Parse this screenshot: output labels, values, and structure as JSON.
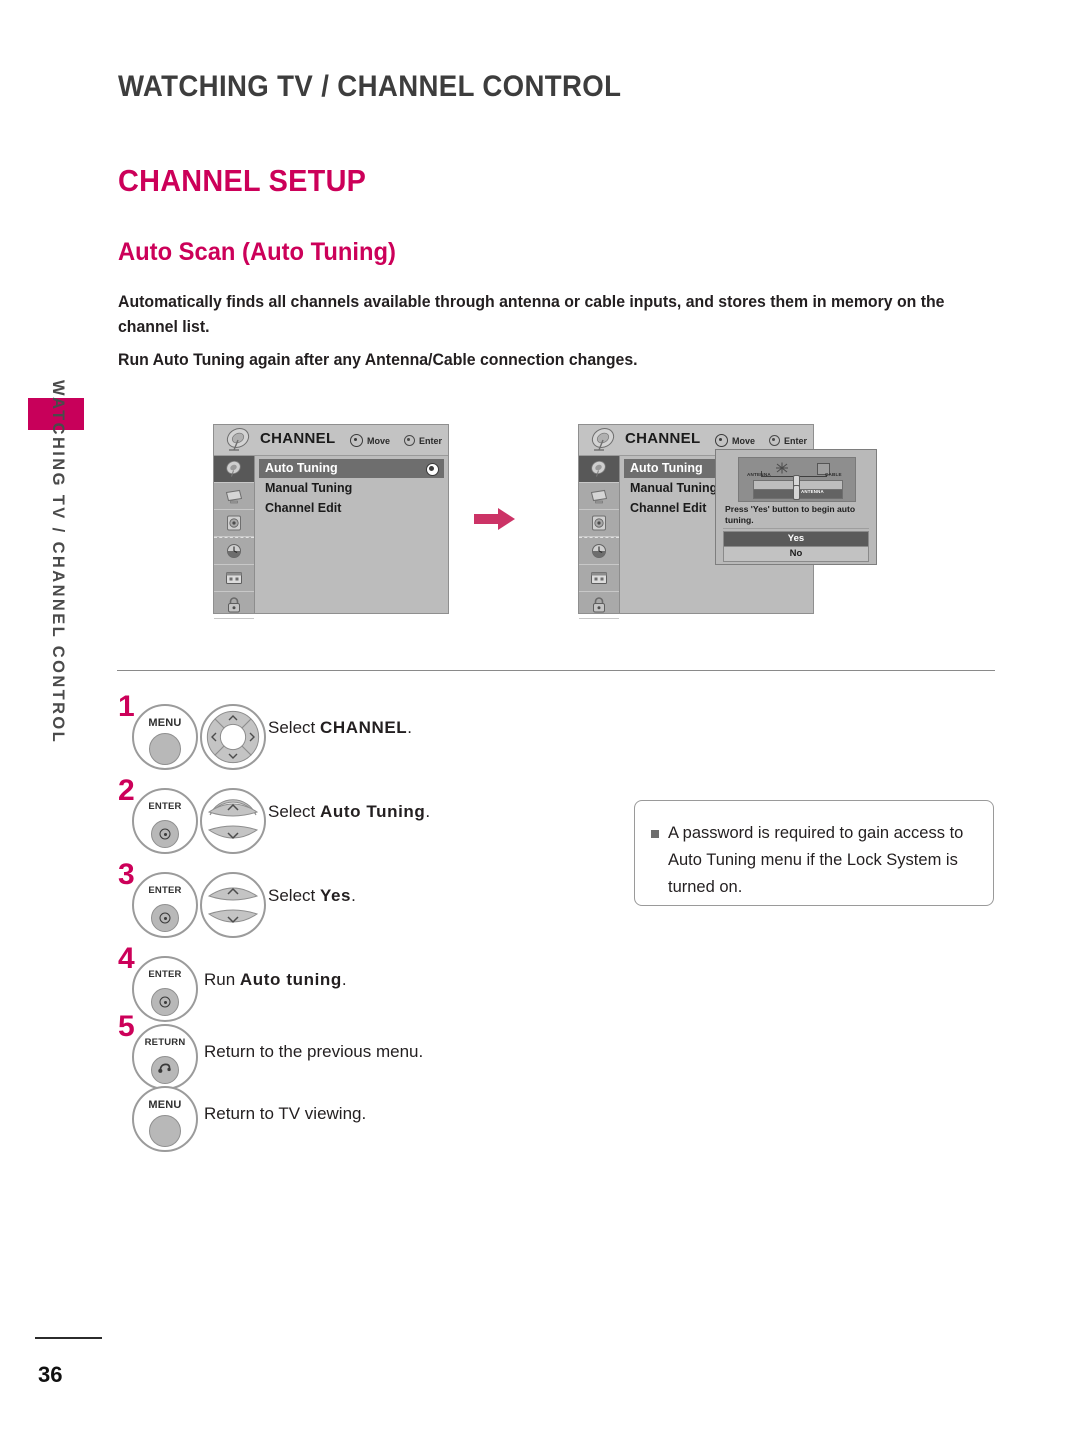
{
  "chapter_tab": {
    "vertical_label": "WATCHING TV / CHANNEL CONTROL",
    "accent_color": "#c8005a"
  },
  "header": {
    "title": "WATCHING TV / CHANNEL CONTROL"
  },
  "section": {
    "title": "CHANNEL SETUP",
    "subtitle": "Auto Scan (Auto Tuning)",
    "accent_color": "#cc0059"
  },
  "intro": {
    "paragraph1": "Automatically finds all channels available through antenna or cable inputs, and stores them in memory on the channel list.",
    "paragraph2": "Run Auto Tuning again after any Antenna/Cable connection changes."
  },
  "osd": {
    "title": "CHANNEL",
    "hint_move": "Move",
    "hint_enter": "Enter",
    "menu_items": [
      {
        "label": "Auto Tuning",
        "selected": true
      },
      {
        "label": "Manual Tuning",
        "selected": false
      },
      {
        "label": "Channel Edit",
        "selected": false
      }
    ],
    "rail_icons": [
      "channel-dish-icon",
      "picture-tv-icon",
      "audio-speaker-icon",
      "time-clock-icon",
      "option-calendar-icon",
      "lock-padlock-icon"
    ]
  },
  "dialog": {
    "graphic_label_antenna": "ANTENNA",
    "graphic_label_cable": "CABLE",
    "graphic_label_selected": "ANTENNA",
    "message": "Press 'Yes' button to begin auto tuning.",
    "buttons": [
      {
        "label": "Yes",
        "selected": true
      },
      {
        "label": "No",
        "selected": false
      }
    ]
  },
  "flow": {
    "arrow_icon": "right-arrow-icon",
    "arrow_color": "#cc3366"
  },
  "steps": [
    {
      "number": "1",
      "button_label": "MENU",
      "button_type": "menu",
      "wheel": "four-way",
      "text_prefix": "Select ",
      "text_bold": "CHANNEL",
      "text_suffix": "."
    },
    {
      "number": "2",
      "button_label": "ENTER",
      "button_type": "enter",
      "wheel": "up-down",
      "text_prefix": "Select ",
      "text_bold": "Auto Tuning",
      "text_suffix": "."
    },
    {
      "number": "3",
      "button_label": "ENTER",
      "button_type": "enter",
      "wheel": "up-down",
      "text_prefix": "Select ",
      "text_bold": "Yes",
      "text_suffix": "."
    },
    {
      "number": "4",
      "button_label": "ENTER",
      "button_type": "enter",
      "wheel": "none",
      "text_prefix": "Run ",
      "text_bold": "Auto tuning",
      "text_suffix": "."
    },
    {
      "number": "5",
      "button_label": "RETURN",
      "button_type": "return",
      "wheel": "none",
      "text_prefix": "Return to the previous menu.",
      "text_bold": "",
      "text_suffix": ""
    },
    {
      "number": "",
      "button_label": "MENU",
      "button_type": "menu",
      "wheel": "none",
      "text_prefix": "Return to TV viewing.",
      "text_bold": "",
      "text_suffix": ""
    }
  ],
  "note": {
    "bullet_icon": "square-bullet-icon",
    "text": "A password is required to gain access to Auto Tuning menu if the Lock System is turned on."
  },
  "footer": {
    "page_number": "36"
  }
}
